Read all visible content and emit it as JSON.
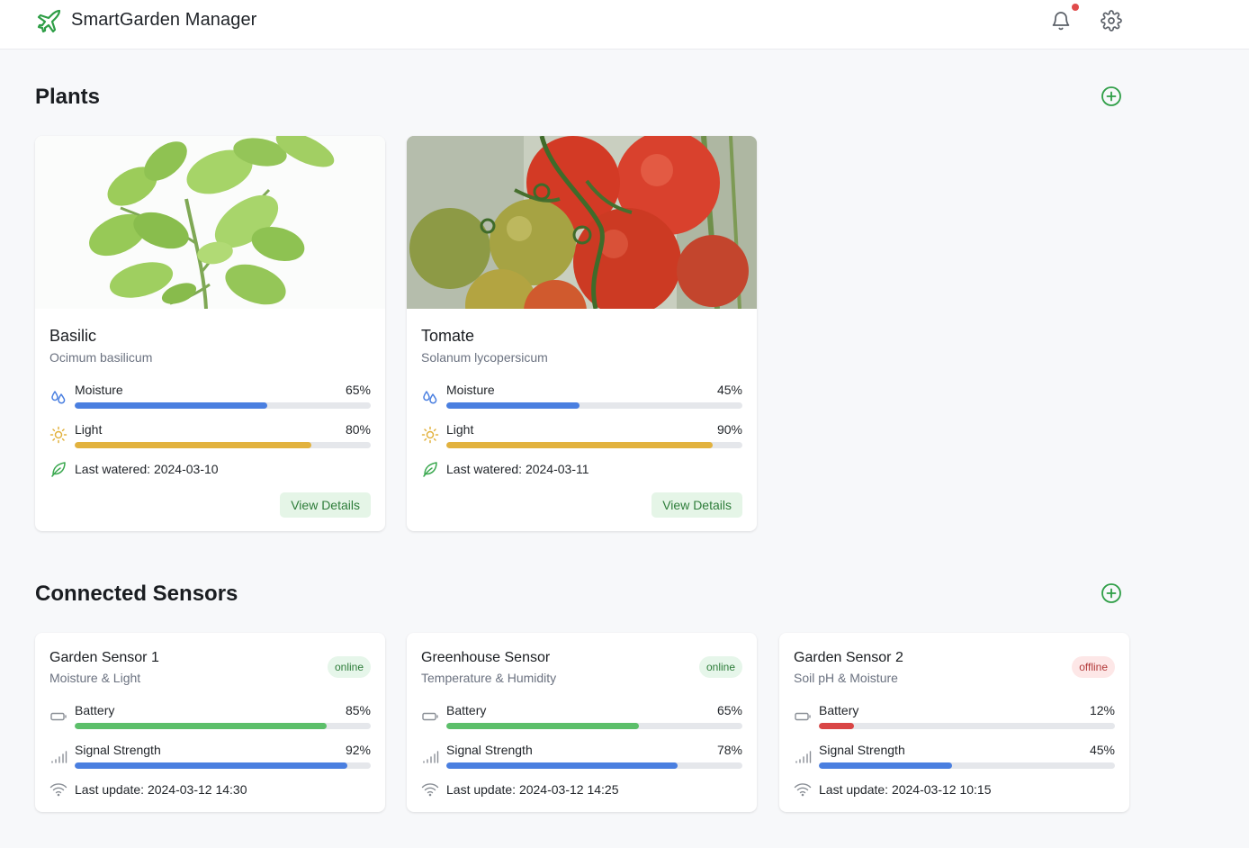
{
  "header": {
    "title": "SmartGarden Manager",
    "logo_icon": "plane-icon",
    "notification_icon": "bell-icon",
    "settings_icon": "gear-icon",
    "has_notification": true
  },
  "plants_section": {
    "title": "Plants",
    "add_icon": "plus-circle-icon",
    "plants": [
      {
        "name": "Basilic",
        "scientific_name": "Ocimum basilicum",
        "image": "basil-plant-photo",
        "moisture_label": "Moisture",
        "moisture_value": "65%",
        "moisture_level": 0.65,
        "light_label": "Light",
        "light_value": "80%",
        "light_level": 0.8,
        "last_watered": "Last watered: 2024-03-10",
        "button_label": "View Details"
      },
      {
        "name": "Tomate",
        "scientific_name": "Solanum lycopersicum",
        "image": "tomato-plant-photo",
        "moisture_label": "Moisture",
        "moisture_value": "45%",
        "moisture_level": 0.45,
        "light_label": "Light",
        "light_value": "90%",
        "light_level": 0.9,
        "last_watered": "Last watered: 2024-03-11",
        "button_label": "View Details"
      }
    ]
  },
  "sensors_section": {
    "title": "Connected Sensors",
    "add_icon": "plus-circle-icon",
    "sensors": [
      {
        "name": "Garden Sensor 1",
        "type": "Moisture & Light",
        "status": "online",
        "battery_label": "Battery",
        "battery_value": "85%",
        "battery_level": 0.85,
        "signal_label": "Signal Strength",
        "signal_value": "92%",
        "signal_level": 0.92,
        "last_update": "Last update: 2024-03-12 14:30"
      },
      {
        "name": "Greenhouse Sensor",
        "type": "Temperature & Humidity",
        "status": "online",
        "battery_label": "Battery",
        "battery_value": "65%",
        "battery_level": 0.65,
        "signal_label": "Signal Strength",
        "signal_value": "78%",
        "signal_level": 0.78,
        "last_update": "Last update: 2024-03-12 14:25"
      },
      {
        "name": "Garden Sensor 2",
        "type": "Soil pH & Moisture",
        "status": "offline",
        "battery_label": "Battery",
        "battery_value": "12%",
        "battery_level": 0.12,
        "signal_label": "Signal Strength",
        "signal_value": "45%",
        "signal_level": 0.45,
        "last_update": "Last update: 2024-03-12 10:15"
      }
    ]
  },
  "colors": {
    "brand_green": "#2e9e46",
    "moisture_bar": "#4a7fe0",
    "light_bar": "#e2b23e",
    "battery_ok": "#5cbf6a",
    "battery_low": "#d94545",
    "signal_bar": "#4a7fe0",
    "online_text": "#2e7d3a",
    "offline_text": "#b33a3a"
  }
}
